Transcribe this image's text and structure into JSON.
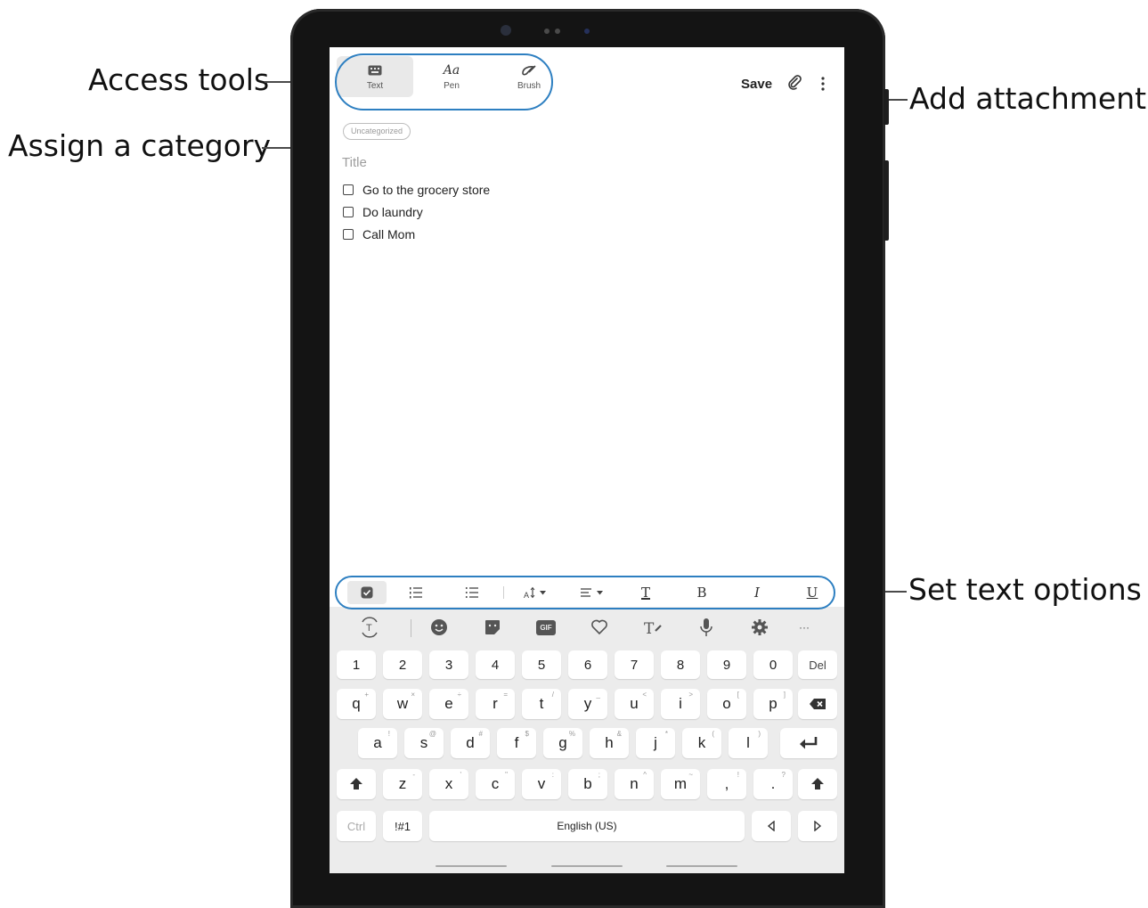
{
  "callouts": {
    "access_tools": "Access tools",
    "assign_category": "Assign a category",
    "add_attachment": "Add attachment",
    "set_text_options": "Set text options"
  },
  "toolbar": {
    "tools": [
      {
        "label": "Text",
        "icon": "keyboard-icon"
      },
      {
        "label": "Pen",
        "icon": "pen-aa-icon"
      },
      {
        "label": "Brush",
        "icon": "brush-icon"
      }
    ],
    "save_label": "Save",
    "attach_icon": "paperclip-icon",
    "more_icon": "more-vertical-icon"
  },
  "note": {
    "category": "Uncategorized",
    "title_placeholder": "Title",
    "checklist": [
      "Go to the grocery store",
      "Do laundry",
      "Call Mom"
    ]
  },
  "format_bar": {
    "pen_glyph": "Aa",
    "bold": "B",
    "italic": "I",
    "underline": "U",
    "text_color": "T"
  },
  "keyboard": {
    "toolbar_icons": [
      "translate-icon",
      "emoji-icon",
      "sticker-icon",
      "gif-icon",
      "heart-icon",
      "handwriting-icon",
      "mic-icon",
      "settings-icon",
      "more-icon"
    ],
    "gif_label": "GIF",
    "more_label": "···",
    "number_row": [
      "1",
      "2",
      "3",
      "4",
      "5",
      "6",
      "7",
      "8",
      "9",
      "0"
    ],
    "del_label": "Del",
    "row1": [
      "q",
      "w",
      "e",
      "r",
      "t",
      "y",
      "u",
      "i",
      "o",
      "p"
    ],
    "row1_sup": [
      "+",
      "×",
      "÷",
      "=",
      "/",
      "_",
      "<",
      ">",
      "[",
      "]"
    ],
    "row2": [
      "a",
      "s",
      "d",
      "f",
      "g",
      "h",
      "j",
      "k",
      "l"
    ],
    "row2_sup": [
      "!",
      "@",
      "#",
      "$",
      "%",
      "&",
      "*",
      "(",
      ")"
    ],
    "row3": [
      "z",
      "x",
      "c",
      "v",
      "b",
      "n",
      "m",
      ",",
      "."
    ],
    "row3_sup": [
      "-",
      "'",
      "\"",
      ":",
      ";",
      "^",
      "~",
      "!",
      "?"
    ],
    "ctrl_label": "Ctrl",
    "sym_label": "!#1",
    "space_label": "English (US)"
  },
  "colors": {
    "highlight": "#2d7fc1",
    "bezel": "#141414",
    "keyboard_bg": "#ececec"
  }
}
